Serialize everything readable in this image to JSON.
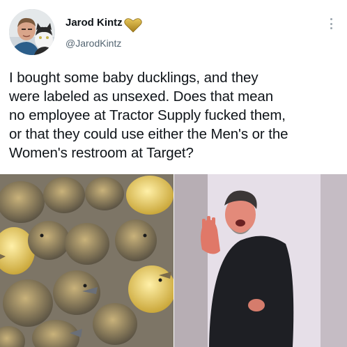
{
  "author": {
    "display_name": "Jarod Kintz",
    "handle": "@JarodKintz",
    "badge_icon": "gold-heart-icon",
    "badge_color": "#c9a227"
  },
  "tweet": {
    "text": "I bought some baby ducklings, and they\nwere labeled as unsexed. Does that mean\nno employee at Tractor Supply fucked them,\nor that they could use either the Men's or the\nWomen's restroom at Target?"
  },
  "media": {
    "left_image": "ducklings-photo",
    "right_image": "man-in-restroom-stall-photo"
  },
  "icons": {
    "more": "more-options-icon"
  }
}
